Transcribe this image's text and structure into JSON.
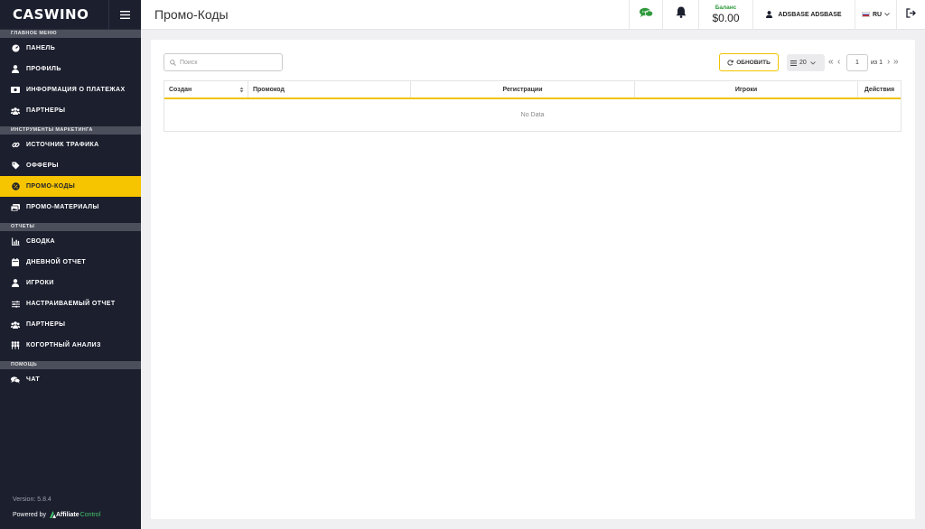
{
  "brand": {
    "logo": "CASWINO"
  },
  "sidebar": {
    "sections": [
      {
        "title": "ГЛАВНОЕ МЕНЮ",
        "items": [
          {
            "label": "ПАНЕЛЬ",
            "icon": "dashboard-icon"
          },
          {
            "label": "ПРОФИЛЬ",
            "icon": "user-icon"
          },
          {
            "label": "ИНФОРМАЦИЯ О ПЛАТЕЖАХ",
            "icon": "money-icon"
          },
          {
            "label": "ПАРТНЕРЫ",
            "icon": "users-icon"
          }
        ]
      },
      {
        "title": "ИНСТРУМЕНТЫ МАРКЕТИНГА",
        "items": [
          {
            "label": "ИСТОЧНИК ТРАФИКА",
            "icon": "link-icon"
          },
          {
            "label": "ОФФЕРЫ",
            "icon": "tag-icon"
          },
          {
            "label": "ПРОМО-КОДЫ",
            "icon": "percent-icon",
            "active": true
          },
          {
            "label": "ПРОМО-МАТЕРИАЛЫ",
            "icon": "images-icon"
          }
        ]
      },
      {
        "title": "ОТЧЕТЫ",
        "items": [
          {
            "label": "СВОДКА",
            "icon": "chart-icon"
          },
          {
            "label": "ДНЕВНОЙ ОТЧЕТ",
            "icon": "calendar-icon"
          },
          {
            "label": "ИГРОКИ",
            "icon": "user-icon"
          },
          {
            "label": "НАСТРАИВАЕМЫЙ ОТЧЕТ",
            "icon": "sliders-icon"
          },
          {
            "label": "ПАРТНЕРЫ",
            "icon": "users-icon"
          },
          {
            "label": "КОГОРТНЫЙ АНАЛИЗ",
            "icon": "group-icon"
          }
        ]
      },
      {
        "title": "ПОМОЩЬ",
        "items": [
          {
            "label": "ЧАТ",
            "icon": "comments-icon"
          }
        ]
      }
    ],
    "version": "Version: 5.8.4",
    "powered_by": "Powered by",
    "powered_brand": "Affiliate",
    "powered_brand_suffix": "Control"
  },
  "topbar": {
    "title": "Промо-Коды",
    "balance_label": "Баланс",
    "balance_value": "$0.00",
    "user_name": "ADSBASE ADSBASE",
    "language": "RU"
  },
  "toolbar": {
    "search_placeholder": "Поиск",
    "refresh_label": "ОБНОВИТЬ",
    "page_size": "20",
    "current_page": "1",
    "of_pages": "из 1"
  },
  "table": {
    "columns": [
      "Создан",
      "Промокод",
      "Регистрации",
      "Игроки",
      "Действия"
    ],
    "empty_text": "No Data"
  },
  "colors": {
    "sidebar_bg": "#1c1f2e",
    "accent": "#f7c400",
    "balance_green": "#2e9a3c"
  }
}
